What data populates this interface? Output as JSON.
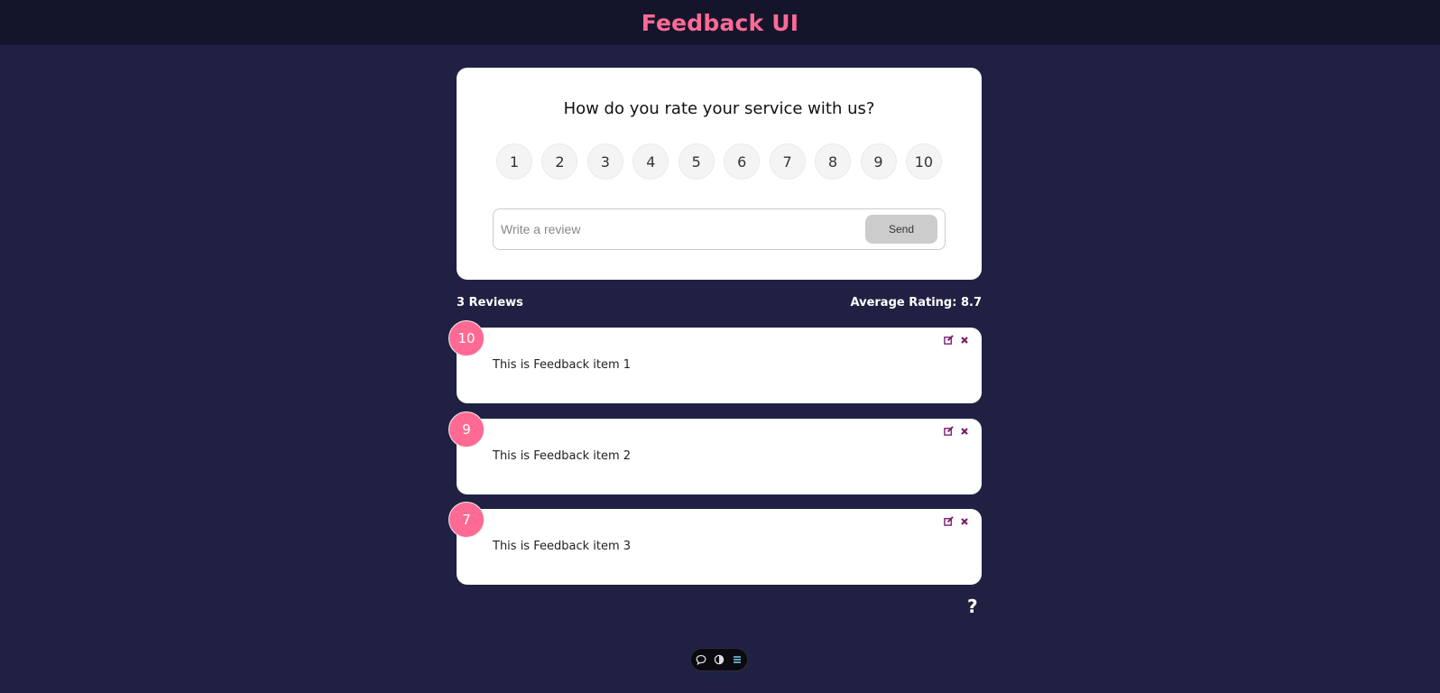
{
  "header": {
    "title": "Feedback UI"
  },
  "rating_form": {
    "question": "How do you rate your service with us?",
    "options": [
      "1",
      "2",
      "3",
      "4",
      "5",
      "6",
      "7",
      "8",
      "9",
      "10"
    ],
    "review_placeholder": "Write a review",
    "review_value": "",
    "send_label": "Send"
  },
  "stats": {
    "count_text": "3 Reviews",
    "average_text": "Average Rating: 8.7"
  },
  "reviews": [
    {
      "rating": "10",
      "text": "This is Feedback item 1"
    },
    {
      "rating": "9",
      "text": "This is Feedback item 2"
    },
    {
      "rating": "7",
      "text": "This is Feedback item 3"
    }
  ],
  "help": {
    "label": "?"
  },
  "toolbar": {
    "icons": [
      "comment-icon",
      "toggle-icon",
      "menu-icon"
    ]
  },
  "colors": {
    "background": "#202142",
    "header_bg": "#14152b",
    "accent": "#ff6a95",
    "action_icon": "#7a1b6f"
  }
}
